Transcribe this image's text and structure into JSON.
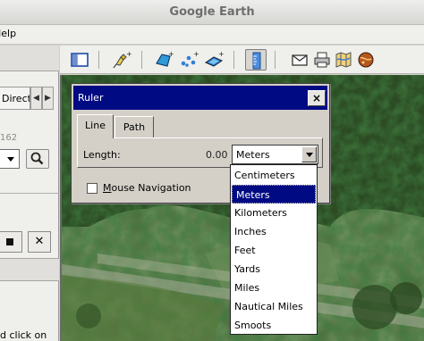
{
  "window": {
    "title": "Google Earth"
  },
  "menubar": {
    "help_label": "Help"
  },
  "left_panel": {
    "direct_tab_label": "Direct",
    "prev_glyph": "◀",
    "next_glyph": "▶",
    "number_text": "162",
    "close_glyph": "✕",
    "hint_text": "d click on"
  },
  "toolbar": {
    "icons": [
      "sidebar-toggle-icon",
      "add-placemark-icon",
      "add-polygon-icon",
      "add-path-icon",
      "add-image-overlay-icon",
      "ruler-icon",
      "email-icon",
      "print-icon",
      "map-view-icon",
      "sky-icon"
    ],
    "pressed": "ruler-icon"
  },
  "ruler_dialog": {
    "title": "Ruler",
    "close_glyph": "×",
    "tabs": [
      {
        "label": "Line",
        "active": true
      },
      {
        "label": "Path",
        "active": false
      }
    ],
    "length_label": "Length:",
    "length_value": "0.00",
    "unit_selected": "Meters",
    "unit_options": [
      "Centimeters",
      "Meters",
      "Kilometers",
      "Inches",
      "Feet",
      "Yards",
      "Miles",
      "Nautical Miles",
      "Smoots"
    ],
    "selected_index": 1,
    "mouse_nav_label": "Mouse Navigation",
    "mouse_nav_checked": false
  },
  "colors": {
    "title_bar_active": "#000b83",
    "selection": "#000b83",
    "dialog_face": "#d4d0c8"
  }
}
